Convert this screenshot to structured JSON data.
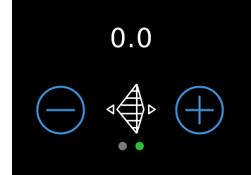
{
  "display": {
    "value": "0.0"
  },
  "controls": {
    "decrease_icon": "minus-circle-icon",
    "increase_icon": "plus-circle-icon",
    "center_icon": "stitch-width-icon"
  },
  "pager": {
    "page_count": 2,
    "active_page": 2
  },
  "colors": {
    "background": "#000000",
    "text": "#ffffff",
    "accent": "#3d8fd6",
    "dot_inactive": "#7a7a7a",
    "dot_active": "#2ebd3a"
  }
}
